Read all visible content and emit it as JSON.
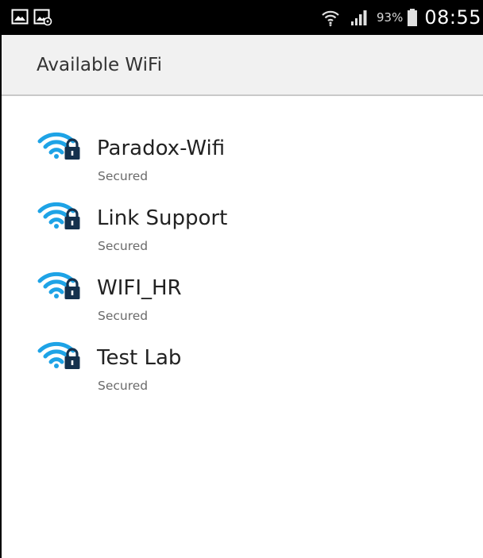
{
  "status_bar": {
    "left_icons": [
      "image-notification-icon",
      "screenshot-notification-icon"
    ],
    "battery_percent": "93%",
    "time": "08:55",
    "icons": {
      "wifi": "wifi-status-icon",
      "signal": "signal-strength-icon",
      "battery": "battery-icon"
    }
  },
  "header": {
    "title": "Available WiFi"
  },
  "colors": {
    "wifi_blue": "#1ea3e6",
    "lock_dark": "#14314d",
    "status_bar_bg": "#000000",
    "app_bar_bg": "#f1f1f1"
  },
  "networks": [
    {
      "name": "Paradox-Wifi",
      "status": "Secured",
      "icon": "wifi-lock-icon"
    },
    {
      "name": "Link Support",
      "status": "Secured",
      "icon": "wifi-lock-icon"
    },
    {
      "name": "WIFI_HR",
      "status": "Secured",
      "icon": "wifi-lock-icon"
    },
    {
      "name": "Test Lab",
      "status": "Secured",
      "icon": "wifi-lock-icon"
    }
  ]
}
